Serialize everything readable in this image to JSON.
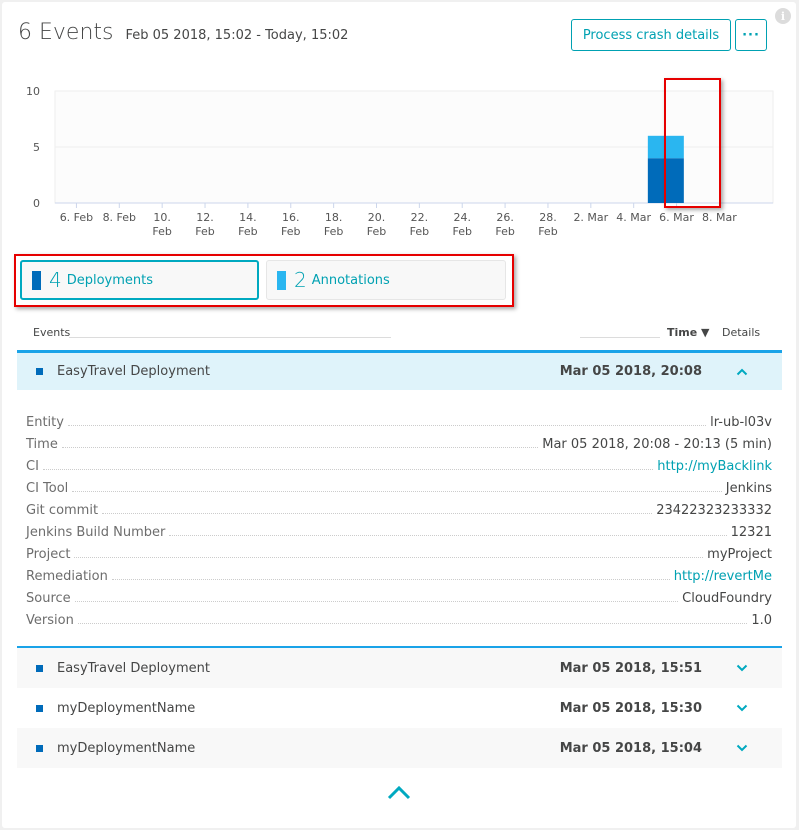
{
  "header": {
    "title": "6 Events",
    "range": "Feb 05 2018, 15:02 - Today, 15:02",
    "process_crash_button": "Process crash details",
    "more_button": "···",
    "info_icon": "i"
  },
  "colors": {
    "accent": "#00a1b2",
    "deployments": "#006bba",
    "annotations": "#2ab6f0",
    "highlight": "#e60000",
    "expanded_row_bg": "#dff3fa",
    "expanded_border": "#1aa3e8"
  },
  "chart_data": {
    "type": "bar",
    "stacked": true,
    "title": "",
    "xlabel": "",
    "ylabel": "",
    "ylim": [
      0,
      10
    ],
    "yticks": [
      "0",
      "5",
      "10"
    ],
    "xlim_days": [
      0,
      33.5
    ],
    "xticks": [
      {
        "day": 1,
        "label": [
          "6. Feb"
        ]
      },
      {
        "day": 3,
        "label": [
          "8. Feb"
        ]
      },
      {
        "day": 5,
        "label": [
          "10.",
          "Feb"
        ]
      },
      {
        "day": 7,
        "label": [
          "12.",
          "Feb"
        ]
      },
      {
        "day": 9,
        "label": [
          "14.",
          "Feb"
        ]
      },
      {
        "day": 11,
        "label": [
          "16.",
          "Feb"
        ]
      },
      {
        "day": 13,
        "label": [
          "18.",
          "Feb"
        ]
      },
      {
        "day": 15,
        "label": [
          "20.",
          "Feb"
        ]
      },
      {
        "day": 17,
        "label": [
          "22.",
          "Feb"
        ]
      },
      {
        "day": 19,
        "label": [
          "24.",
          "Feb"
        ]
      },
      {
        "day": 21,
        "label": [
          "26.",
          "Feb"
        ]
      },
      {
        "day": 23,
        "label": [
          "28.",
          "Feb"
        ]
      },
      {
        "day": 25,
        "label": [
          "2. Mar"
        ]
      },
      {
        "day": 27,
        "label": [
          "4. Mar"
        ]
      },
      {
        "day": 29,
        "label": [
          "6. Mar"
        ]
      },
      {
        "day": 31,
        "label": [
          "8. Mar"
        ]
      }
    ],
    "categories": [
      "5. Mar"
    ],
    "bar_day": 28,
    "series": [
      {
        "name": "Deployments",
        "color": "#006bba",
        "values": [
          4
        ]
      },
      {
        "name": "Annotations",
        "color": "#2ab6f0",
        "values": [
          2
        ]
      }
    ],
    "grid": true,
    "legend": "none"
  },
  "tabs": [
    {
      "count": "4",
      "label": "Deployments",
      "color": "#006bba",
      "active": true
    },
    {
      "count": "2",
      "label": "Annotations",
      "color": "#2ab6f0",
      "active": false
    }
  ],
  "table": {
    "col_events": "Events",
    "col_time": "Time ▼",
    "col_details": "Details"
  },
  "events": [
    {
      "name": "EasyTravel Deployment",
      "time": "Mar 05 2018, 20:08",
      "expanded": true
    },
    {
      "name": "EasyTravel Deployment",
      "time": "Mar 05 2018, 15:51",
      "expanded": false
    },
    {
      "name": "myDeploymentName",
      "time": "Mar 05 2018, 15:30",
      "expanded": false
    },
    {
      "name": "myDeploymentName",
      "time": "Mar 05 2018, 15:04",
      "expanded": false
    }
  ],
  "details": [
    {
      "key": "Entity",
      "value": "lr-ub-l03v",
      "link": false
    },
    {
      "key": "Time",
      "value": "Mar 05 2018, 20:08 - 20:13 (5 min)",
      "link": false
    },
    {
      "key": "CI",
      "value": "http://myBacklink",
      "link": true
    },
    {
      "key": "CI Tool",
      "value": "Jenkins",
      "link": false
    },
    {
      "key": "Git commit",
      "value": "23422323233332",
      "link": false
    },
    {
      "key": "Jenkins Build Number",
      "value": "12321",
      "link": false
    },
    {
      "key": "Project",
      "value": "myProject",
      "link": false
    },
    {
      "key": "Remediation",
      "value": "http://revertMe",
      "link": true
    },
    {
      "key": "Source",
      "value": "CloudFoundry",
      "link": false
    },
    {
      "key": "Version",
      "value": "1.0",
      "link": false
    }
  ]
}
